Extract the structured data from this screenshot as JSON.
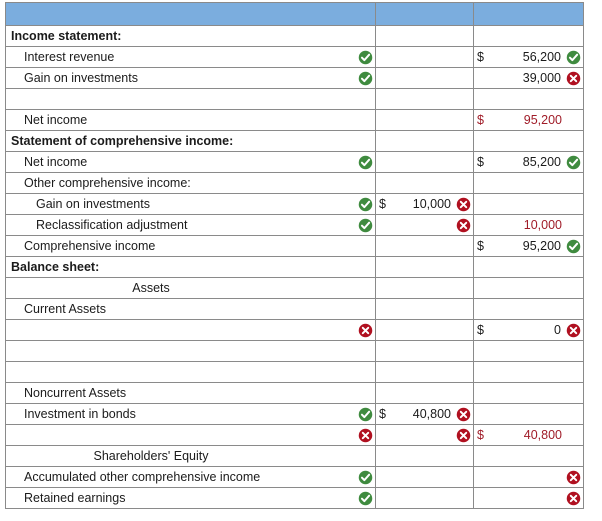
{
  "doc": {
    "title": "Financial statement worksheet",
    "colors": {
      "header_blue": "#7badde",
      "correct_green": "#3f8b3f",
      "incorrect_red": "#b01020",
      "value_red": "#a01c28",
      "ok_tint": "#f6faf4",
      "bad_tint": "#fdf1f1",
      "grid_line": "#8a8a8a"
    },
    "icons": {
      "correct": "check-circle-icon",
      "incorrect": "x-circle-icon"
    }
  },
  "columns": [
    {
      "key": "label",
      "header": ""
    },
    {
      "key": "middle",
      "header": ""
    },
    {
      "key": "right",
      "header": ""
    }
  ],
  "rows": [
    {
      "label": "Income statement:",
      "indent": 0,
      "bold": true,
      "align": "left",
      "label_mark": "",
      "label_tint": "plain",
      "mid": {
        "currency": "",
        "amount": "",
        "mark": "",
        "tint": "plain",
        "rule": false,
        "color": "black"
      },
      "right": {
        "currency": "",
        "amount": "",
        "mark": "",
        "tint": "plain",
        "rule": false,
        "color": "black"
      }
    },
    {
      "label": "Interest revenue",
      "indent": 1,
      "bold": false,
      "align": "left",
      "label_mark": "correct",
      "label_tint": "ok",
      "mid": {
        "currency": "",
        "amount": "",
        "mark": "",
        "tint": "plain",
        "rule": false,
        "color": "black"
      },
      "right": {
        "currency": "$",
        "amount": "56,200",
        "mark": "correct",
        "tint": "ok",
        "rule": false,
        "color": "black"
      }
    },
    {
      "label": "Gain on investments",
      "indent": 1,
      "bold": false,
      "align": "left",
      "label_mark": "correct",
      "label_tint": "ok",
      "mid": {
        "currency": "",
        "amount": "",
        "mark": "",
        "tint": "plain",
        "rule": false,
        "color": "black"
      },
      "right": {
        "currency": "",
        "amount": "39,000",
        "mark": "incorrect",
        "tint": "bad",
        "rule": false,
        "color": "black"
      }
    },
    {
      "label": "",
      "indent": 1,
      "bold": false,
      "align": "left",
      "label_mark": "",
      "label_tint": "plain",
      "mid": {
        "currency": "",
        "amount": "",
        "mark": "",
        "tint": "plain",
        "rule": false,
        "color": "black"
      },
      "right": {
        "currency": "",
        "amount": "",
        "mark": "",
        "tint": "plain",
        "rule": false,
        "color": "black"
      }
    },
    {
      "label": "Net income",
      "indent": 1,
      "bold": false,
      "align": "left",
      "label_mark": "",
      "label_tint": "plain",
      "mid": {
        "currency": "",
        "amount": "",
        "mark": "",
        "tint": "plain",
        "rule": false,
        "color": "black"
      },
      "right": {
        "currency": "$",
        "amount": "95,200",
        "mark": "",
        "tint": "plain",
        "rule": true,
        "color": "red"
      }
    },
    {
      "label": "Statement of comprehensive income:",
      "indent": 0,
      "bold": true,
      "align": "left",
      "label_mark": "",
      "label_tint": "plain",
      "mid": {
        "currency": "",
        "amount": "",
        "mark": "",
        "tint": "plain",
        "rule": false,
        "color": "black"
      },
      "right": {
        "currency": "",
        "amount": "",
        "mark": "",
        "tint": "plain",
        "rule": false,
        "color": "black"
      }
    },
    {
      "label": "Net income",
      "indent": 1,
      "bold": false,
      "align": "left",
      "label_mark": "correct",
      "label_tint": "ok",
      "mid": {
        "currency": "",
        "amount": "",
        "mark": "",
        "tint": "plain",
        "rule": false,
        "color": "black"
      },
      "right": {
        "currency": "$",
        "amount": "85,200",
        "mark": "correct",
        "tint": "ok",
        "rule": false,
        "color": "black"
      }
    },
    {
      "label": "Other comprehensive income:",
      "indent": 1,
      "bold": false,
      "align": "left",
      "label_mark": "",
      "label_tint": "plain",
      "mid": {
        "currency": "",
        "amount": "",
        "mark": "",
        "tint": "plain",
        "rule": false,
        "color": "black"
      },
      "right": {
        "currency": "",
        "amount": "",
        "mark": "",
        "tint": "plain",
        "rule": false,
        "color": "black"
      }
    },
    {
      "label": "Gain on investments",
      "indent": 2,
      "bold": false,
      "align": "left",
      "label_mark": "correct",
      "label_tint": "ok",
      "mid": {
        "currency": "$",
        "amount": "10,000",
        "mark": "incorrect",
        "tint": "bad",
        "rule": false,
        "color": "black"
      },
      "right": {
        "currency": "",
        "amount": "",
        "mark": "",
        "tint": "plain",
        "rule": false,
        "color": "black"
      }
    },
    {
      "label": "Reclassification adjustment",
      "indent": 2,
      "bold": false,
      "align": "left",
      "label_mark": "correct",
      "label_tint": "ok",
      "mid": {
        "currency": "",
        "amount": "",
        "mark": "incorrect",
        "tint": "bad",
        "rule": false,
        "color": "black"
      },
      "right": {
        "currency": "",
        "amount": "10,000",
        "mark": "",
        "tint": "plain",
        "rule": false,
        "color": "red"
      }
    },
    {
      "label": "Comprehensive income",
      "indent": 1,
      "bold": false,
      "align": "left",
      "label_mark": "",
      "label_tint": "plain",
      "mid": {
        "currency": "",
        "amount": "",
        "mark": "",
        "tint": "plain",
        "rule": false,
        "color": "black"
      },
      "right": {
        "currency": "$",
        "amount": "95,200",
        "mark": "correct",
        "tint": "ok",
        "rule": true,
        "color": "black"
      }
    },
    {
      "label": "Balance sheet:",
      "indent": 0,
      "bold": true,
      "align": "left",
      "label_mark": "",
      "label_tint": "plain",
      "mid": {
        "currency": "",
        "amount": "",
        "mark": "",
        "tint": "plain",
        "rule": false,
        "color": "black"
      },
      "right": {
        "currency": "",
        "amount": "",
        "mark": "",
        "tint": "plain",
        "rule": false,
        "color": "black"
      }
    },
    {
      "label": "Assets",
      "indent": 0,
      "bold": false,
      "align": "center",
      "label_mark": "",
      "label_tint": "plain",
      "mid": {
        "currency": "",
        "amount": "",
        "mark": "",
        "tint": "plain",
        "rule": false,
        "color": "black"
      },
      "right": {
        "currency": "",
        "amount": "",
        "mark": "",
        "tint": "plain",
        "rule": false,
        "color": "black"
      }
    },
    {
      "label": "Current Assets",
      "indent": 1,
      "bold": false,
      "align": "left",
      "label_mark": "",
      "label_tint": "plain",
      "mid": {
        "currency": "",
        "amount": "",
        "mark": "",
        "tint": "plain",
        "rule": false,
        "color": "black"
      },
      "right": {
        "currency": "",
        "amount": "",
        "mark": "",
        "tint": "plain",
        "rule": false,
        "color": "black"
      }
    },
    {
      "label": "",
      "indent": 1,
      "bold": false,
      "align": "left",
      "label_mark": "incorrect",
      "label_tint": "bad",
      "mid": {
        "currency": "",
        "amount": "",
        "mark": "",
        "tint": "plain",
        "rule": false,
        "color": "black"
      },
      "right": {
        "currency": "$",
        "amount": "0",
        "mark": "incorrect",
        "tint": "bad",
        "rule": false,
        "color": "black"
      }
    },
    {
      "label": "",
      "indent": 1,
      "bold": false,
      "align": "left",
      "label_mark": "",
      "label_tint": "plain",
      "mid": {
        "currency": "",
        "amount": "",
        "mark": "",
        "tint": "plain",
        "rule": false,
        "color": "black"
      },
      "right": {
        "currency": "",
        "amount": "",
        "mark": "",
        "tint": "plain",
        "rule": false,
        "color": "black"
      }
    },
    {
      "label": "",
      "indent": 1,
      "bold": false,
      "align": "left",
      "label_mark": "",
      "label_tint": "plain",
      "mid": {
        "currency": "",
        "amount": "",
        "mark": "",
        "tint": "plain",
        "rule": false,
        "color": "black"
      },
      "right": {
        "currency": "",
        "amount": "",
        "mark": "",
        "tint": "plain",
        "rule": false,
        "color": "black"
      }
    },
    {
      "label": "Noncurrent Assets",
      "indent": 1,
      "bold": false,
      "align": "left",
      "label_mark": "",
      "label_tint": "plain",
      "mid": {
        "currency": "",
        "amount": "",
        "mark": "",
        "tint": "plain",
        "rule": false,
        "color": "black"
      },
      "right": {
        "currency": "",
        "amount": "",
        "mark": "",
        "tint": "plain",
        "rule": false,
        "color": "black"
      }
    },
    {
      "label": "Investment in bonds",
      "indent": 1,
      "bold": false,
      "align": "left",
      "label_mark": "correct",
      "label_tint": "ok",
      "mid": {
        "currency": "$",
        "amount": "40,800",
        "mark": "incorrect",
        "tint": "bad",
        "rule": false,
        "color": "black"
      },
      "right": {
        "currency": "",
        "amount": "",
        "mark": "",
        "tint": "plain",
        "rule": false,
        "color": "black"
      }
    },
    {
      "label": "",
      "indent": 1,
      "bold": false,
      "align": "left",
      "label_mark": "incorrect",
      "label_tint": "bad",
      "mid": {
        "currency": "",
        "amount": "",
        "mark": "incorrect",
        "tint": "bad",
        "rule": false,
        "color": "black"
      },
      "right": {
        "currency": "$",
        "amount": "40,800",
        "mark": "",
        "tint": "plain",
        "rule": false,
        "color": "red"
      }
    },
    {
      "label": "Shareholders' Equity",
      "indent": 0,
      "bold": false,
      "align": "center",
      "label_mark": "",
      "label_tint": "plain",
      "mid": {
        "currency": "",
        "amount": "",
        "mark": "",
        "tint": "plain",
        "rule": true,
        "color": "black"
      },
      "right": {
        "currency": "",
        "amount": "",
        "mark": "",
        "tint": "plain",
        "rule": false,
        "color": "black"
      }
    },
    {
      "label": "Accumulated other comprehensive income",
      "indent": 1,
      "bold": false,
      "align": "left",
      "label_mark": "correct",
      "label_tint": "ok",
      "mid": {
        "currency": "",
        "amount": "",
        "mark": "",
        "tint": "plain",
        "rule": false,
        "color": "black"
      },
      "right": {
        "currency": "",
        "amount": "",
        "mark": "incorrect",
        "tint": "bad",
        "rule": false,
        "color": "black"
      }
    },
    {
      "label": "Retained earnings",
      "indent": 1,
      "bold": false,
      "align": "left",
      "label_mark": "correct",
      "label_tint": "ok",
      "mid": {
        "currency": "",
        "amount": "",
        "mark": "",
        "tint": "plain",
        "rule": false,
        "color": "black"
      },
      "right": {
        "currency": "",
        "amount": "",
        "mark": "incorrect",
        "tint": "bad",
        "rule": false,
        "color": "black"
      }
    }
  ]
}
